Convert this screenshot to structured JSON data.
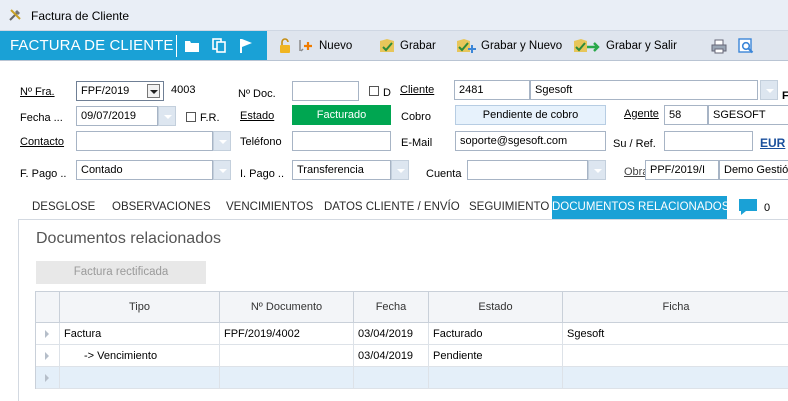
{
  "window": {
    "title": "Factura de Cliente"
  },
  "toolbar": {
    "brand": "FACTURA DE CLIENTE",
    "nuevo": "Nuevo",
    "grabar": "Grabar",
    "grabar_nuevo": "Grabar y Nuevo",
    "grabar_salir": "Grabar y Salir"
  },
  "form": {
    "nfra_label": "Nº Fra.",
    "nfra_serie": "FPF/2019",
    "nfra_num": "4003",
    "ndoc_label": "Nº Doc.",
    "ndoc_value": "",
    "d_label": "D",
    "cliente_label": "Cliente",
    "cliente_code": "2481",
    "cliente_name": "Sgesoft",
    "f_tail": "F",
    "fecha_label": "Fecha ...",
    "fecha_value": "09/07/2019",
    "fr_label": "F.R.",
    "estado_label": "Estado",
    "estado_value": "Facturado",
    "cobro_label": "Cobro",
    "cobro_value": "Pendiente de cobro",
    "agente_label": "Agente",
    "agente_code": "58",
    "agente_name": "SGESOFT",
    "contacto_label": "Contacto",
    "contacto_value": "",
    "telefono_label": "Teléfono",
    "telefono_value": "",
    "email_label": "E-Mail",
    "email_value": "soporte@sgesoft.com",
    "suref_label": "Su / Ref.",
    "suref_value": "",
    "currency": "EUR",
    "fpago_label": "F. Pago ..",
    "fpago_value": "Contado",
    "ipago_label": "I. Pago ..",
    "ipago_value": "Transferencia",
    "cuenta_label": "Cuenta",
    "cuenta_value": "",
    "obra_label": "Obra",
    "obra_code": "PPF/2019/I",
    "obra_name": "Demo Gestión"
  },
  "tabs": [
    {
      "label": "DESGLOSE"
    },
    {
      "label": "OBSERVACIONES"
    },
    {
      "label": "VENCIMIENTOS"
    },
    {
      "label": "DATOS CLIENTE / ENVÍO"
    },
    {
      "label": "SEGUIMIENTO"
    },
    {
      "label": "DOCUMENTOS RELACIONADOS"
    }
  ],
  "comments_count": "0",
  "panel": {
    "title": "Documentos relacionados",
    "rectificada_button": "Factura rectificada"
  },
  "grid": {
    "columns": [
      "Tipo",
      "Nº Documento",
      "Fecha",
      "Estado",
      "Ficha"
    ],
    "rows": [
      [
        "Factura",
        "FPF/2019/4002",
        "03/04/2019",
        "Facturado",
        "Sgesoft"
      ],
      [
        "-> Vencimiento",
        "",
        "03/04/2019",
        "Pendiente",
        ""
      ],
      [
        "",
        "",
        "",
        "",
        ""
      ]
    ]
  },
  "colors": {
    "accent": "#1aa1d6",
    "estado_bg": "#00a651",
    "cobro_bg": "#e7f2fc",
    "link_blue": "#1a4f9c"
  }
}
